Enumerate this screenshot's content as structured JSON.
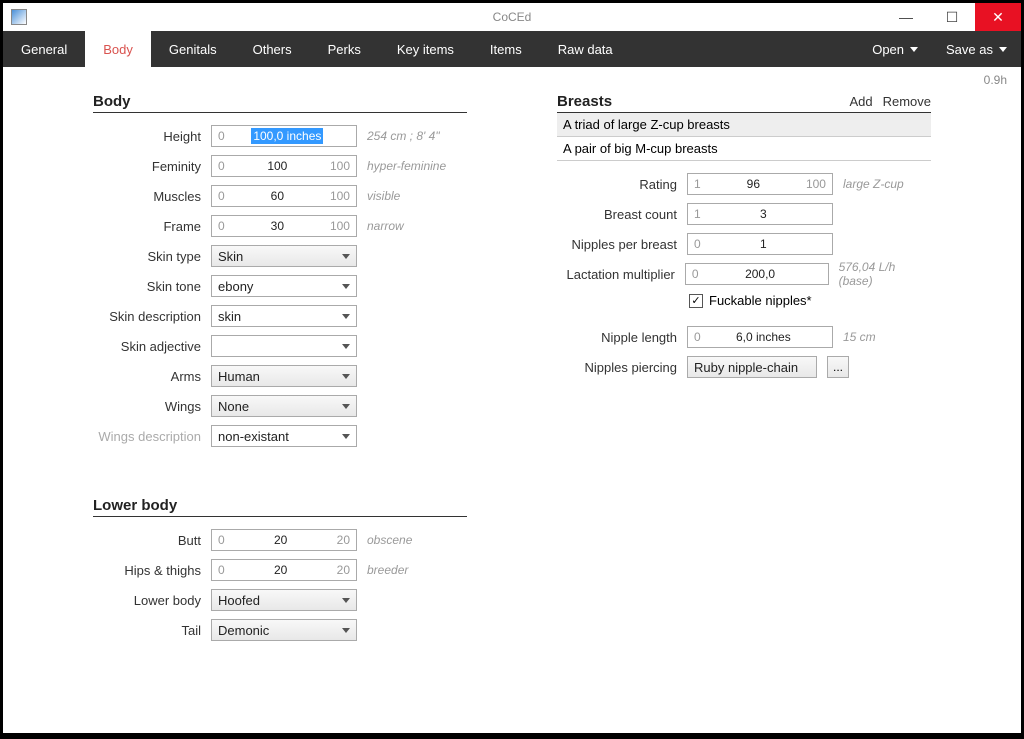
{
  "window": {
    "title": "CoCEd"
  },
  "titlebar_buttons": {
    "min": "—",
    "max": "☐",
    "close": "✕"
  },
  "tabs": [
    "General",
    "Body",
    "Genitals",
    "Others",
    "Perks",
    "Key items",
    "Items",
    "Raw data"
  ],
  "active_tab": "Body",
  "menu": {
    "open": "Open",
    "save_as": "Save as"
  },
  "version": "0.9h",
  "body": {
    "title": "Body",
    "height": {
      "label": "Height",
      "min": "0",
      "val": "100,0 inches",
      "max": "",
      "hint": "254 cm ; 8' 4\""
    },
    "feminity": {
      "label": "Feminity",
      "min": "0",
      "val": "100",
      "max": "100",
      "hint": "hyper-feminine"
    },
    "muscles": {
      "label": "Muscles",
      "min": "0",
      "val": "60",
      "max": "100",
      "hint": "visible"
    },
    "frame": {
      "label": "Frame",
      "min": "0",
      "val": "30",
      "max": "100",
      "hint": "narrow"
    },
    "skin_type": {
      "label": "Skin type",
      "val": "Skin"
    },
    "skin_tone": {
      "label": "Skin tone",
      "val": "ebony"
    },
    "skin_desc": {
      "label": "Skin description",
      "val": "skin"
    },
    "skin_adj": {
      "label": "Skin adjective",
      "val": ""
    },
    "arms": {
      "label": "Arms",
      "val": "Human"
    },
    "wings": {
      "label": "Wings",
      "val": "None"
    },
    "wings_desc": {
      "label": "Wings description",
      "val": "non-existant"
    }
  },
  "lower": {
    "title": "Lower body",
    "butt": {
      "label": "Butt",
      "min": "0",
      "val": "20",
      "max": "20",
      "hint": "obscene"
    },
    "hips": {
      "label": "Hips & thighs",
      "min": "0",
      "val": "20",
      "max": "20",
      "hint": "breeder"
    },
    "lower_body": {
      "label": "Lower body",
      "val": "Hoofed"
    },
    "tail": {
      "label": "Tail",
      "val": "Demonic"
    }
  },
  "breasts": {
    "title": "Breasts",
    "add": "Add",
    "remove": "Remove",
    "rows": [
      "A triad of large Z-cup breasts",
      "A pair of big M-cup breasts"
    ],
    "rating": {
      "label": "Rating",
      "min": "1",
      "val": "96",
      "max": "100",
      "hint": "large Z-cup"
    },
    "count": {
      "label": "Breast count",
      "min": "1",
      "val": "3",
      "max": ""
    },
    "nipples_per": {
      "label": "Nipples per breast",
      "min": "0",
      "val": "1",
      "max": ""
    },
    "lactation": {
      "label": "Lactation multiplier",
      "min": "0",
      "val": "200,0",
      "max": "",
      "hint": "576,04 L/h (base)"
    },
    "fuckable": {
      "label": "Fuckable nipples*",
      "checked": "✓"
    },
    "nipple_len": {
      "label": "Nipple length",
      "min": "0",
      "val": "6,0 inches",
      "max": "",
      "hint": "15 cm"
    },
    "piercing": {
      "label": "Nipples piercing",
      "val": "Ruby nipple-chain",
      "btn": "..."
    }
  }
}
